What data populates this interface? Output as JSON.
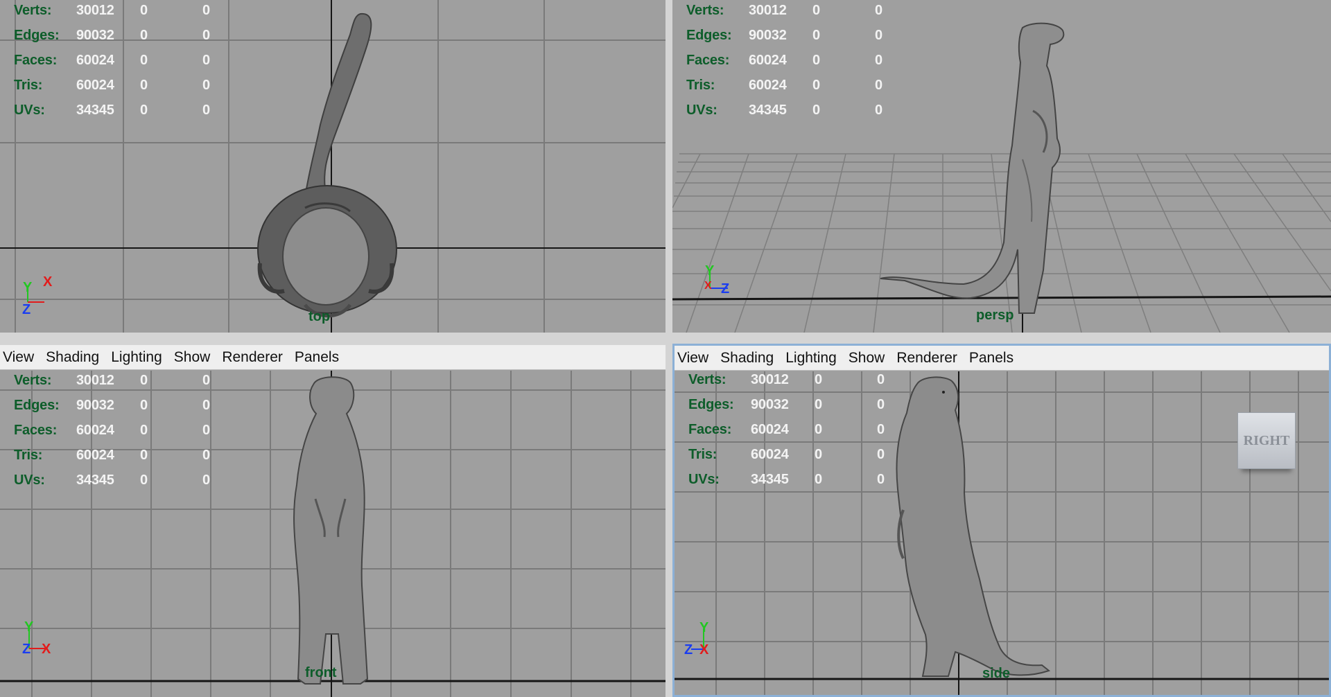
{
  "panels": {
    "top": {
      "camera_label": "top",
      "stats": [
        {
          "label": "Verts:",
          "v1": "30012",
          "v2": "0",
          "v3": "0"
        },
        {
          "label": "Edges:",
          "v1": "90032",
          "v2": "0",
          "v3": "0"
        },
        {
          "label": "Faces:",
          "v1": "60024",
          "v2": "0",
          "v3": "0"
        },
        {
          "label": "Tris:",
          "v1": "60024",
          "v2": "0",
          "v3": "0"
        },
        {
          "label": "UVs:",
          "v1": "34345",
          "v2": "0",
          "v3": "0"
        }
      ],
      "axes": {
        "up": "Y",
        "right": "X",
        "front": "Z"
      }
    },
    "persp": {
      "camera_label": "persp",
      "stats": [
        {
          "label": "Verts:",
          "v1": "30012",
          "v2": "0",
          "v3": "0"
        },
        {
          "label": "Edges:",
          "v1": "90032",
          "v2": "0",
          "v3": "0"
        },
        {
          "label": "Faces:",
          "v1": "60024",
          "v2": "0",
          "v3": "0"
        },
        {
          "label": "Tris:",
          "v1": "60024",
          "v2": "0",
          "v3": "0"
        },
        {
          "label": "UVs:",
          "v1": "34345",
          "v2": "0",
          "v3": "0"
        }
      ],
      "axes": {
        "up": "Y",
        "right": "Z",
        "front": "X"
      }
    },
    "front": {
      "menu": [
        "View",
        "Shading",
        "Lighting",
        "Show",
        "Renderer",
        "Panels"
      ],
      "camera_label": "front",
      "stats": [
        {
          "label": "Verts:",
          "v1": "30012",
          "v2": "0",
          "v3": "0"
        },
        {
          "label": "Edges:",
          "v1": "90032",
          "v2": "0",
          "v3": "0"
        },
        {
          "label": "Faces:",
          "v1": "60024",
          "v2": "0",
          "v3": "0"
        },
        {
          "label": "Tris:",
          "v1": "60024",
          "v2": "0",
          "v3": "0"
        },
        {
          "label": "UVs:",
          "v1": "34345",
          "v2": "0",
          "v3": "0"
        }
      ],
      "axes": {
        "up": "Y",
        "right": "X",
        "front": "Z"
      }
    },
    "side": {
      "menu": [
        "View",
        "Shading",
        "Lighting",
        "Show",
        "Renderer",
        "Panels"
      ],
      "camera_label": "side",
      "viewcube_label": "RIGHT",
      "stats": [
        {
          "label": "Verts:",
          "v1": "30012",
          "v2": "0",
          "v3": "0"
        },
        {
          "label": "Edges:",
          "v1": "90032",
          "v2": "0",
          "v3": "0"
        },
        {
          "label": "Faces:",
          "v1": "60024",
          "v2": "0",
          "v3": "0"
        },
        {
          "label": "Tris:",
          "v1": "60024",
          "v2": "0",
          "v3": "0"
        },
        {
          "label": "UVs:",
          "v1": "34345",
          "v2": "0",
          "v3": "0"
        }
      ],
      "axes": {
        "up": "Y",
        "right": "X",
        "front": "Z"
      }
    }
  },
  "colors": {
    "viewport_bg": "#9f9f9f",
    "grid": "#7a7a7a",
    "axis_line": "#151515",
    "hud_label": "#0d5d2a",
    "active_border": "#8cb0d6"
  }
}
